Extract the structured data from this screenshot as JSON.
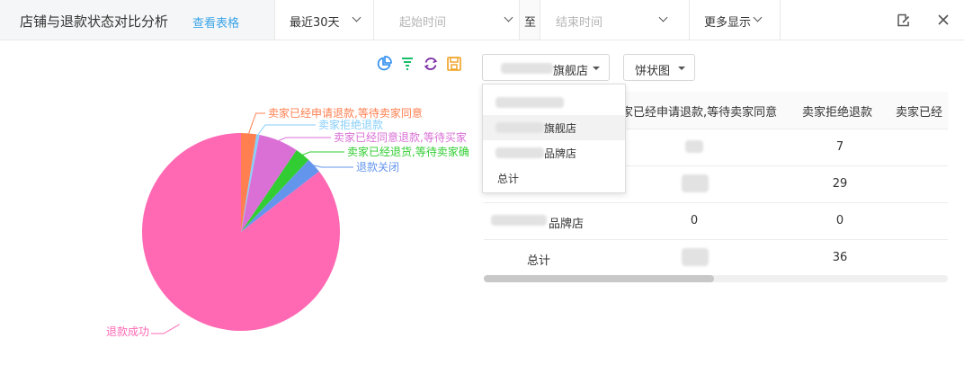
{
  "header": {
    "title": "店铺与退款状态对比分析",
    "view_table": "查看表格",
    "range": "最近30天",
    "start_placeholder": "起始时间",
    "to": "至",
    "end_placeholder": "结束时间",
    "more": "更多显示"
  },
  "toolbox": {
    "icons": [
      "pie-chart-icon",
      "filter-icon",
      "refresh-icon",
      "save-icon"
    ],
    "colors": {
      "pie": "#2d8cf0",
      "filter": "#19be6b",
      "refresh": "#7b2ea3",
      "save": "#f0a020"
    }
  },
  "controls": {
    "store_select": "旗舰店",
    "chart_type": "饼状图"
  },
  "dropdown": {
    "items": [
      {
        "label": ""
      },
      {
        "label": "旗舰店"
      },
      {
        "label": "品牌店"
      },
      {
        "label": "总计"
      }
    ]
  },
  "table": {
    "headers": [
      "卖家已经申请退款,等待卖家同意",
      "卖家拒绝退款",
      "卖家已经"
    ],
    "rows": [
      {
        "store": "",
        "c1": "",
        "c2": "7"
      },
      {
        "store": "",
        "c1": "",
        "c2": "29"
      },
      {
        "store": "品牌店",
        "c1": "0",
        "c2": "0"
      },
      {
        "store": "总计",
        "c1": "",
        "c2": "36"
      }
    ]
  },
  "chart_data": {
    "type": "pie",
    "slices": [
      {
        "name": "退款成功",
        "value": 85.5,
        "color": "#ff69b4"
      },
      {
        "name": "卖家已经申请退款,等待卖家同意",
        "value": 2.5,
        "color": "#ff7f50"
      },
      {
        "name": "卖家拒绝退款",
        "value": 0.5,
        "color": "#87cefa"
      },
      {
        "name": "卖家已经同意退款,等待买家",
        "value": 6.5,
        "color": "#da70d6"
      },
      {
        "name": "卖家已经退货,等待卖家确",
        "value": 2.5,
        "color": "#32cd32"
      },
      {
        "name": "退款关闭",
        "value": 2.5,
        "color": "#6495ed"
      }
    ],
    "start": "退款成功",
    "direction": "clockwise"
  }
}
